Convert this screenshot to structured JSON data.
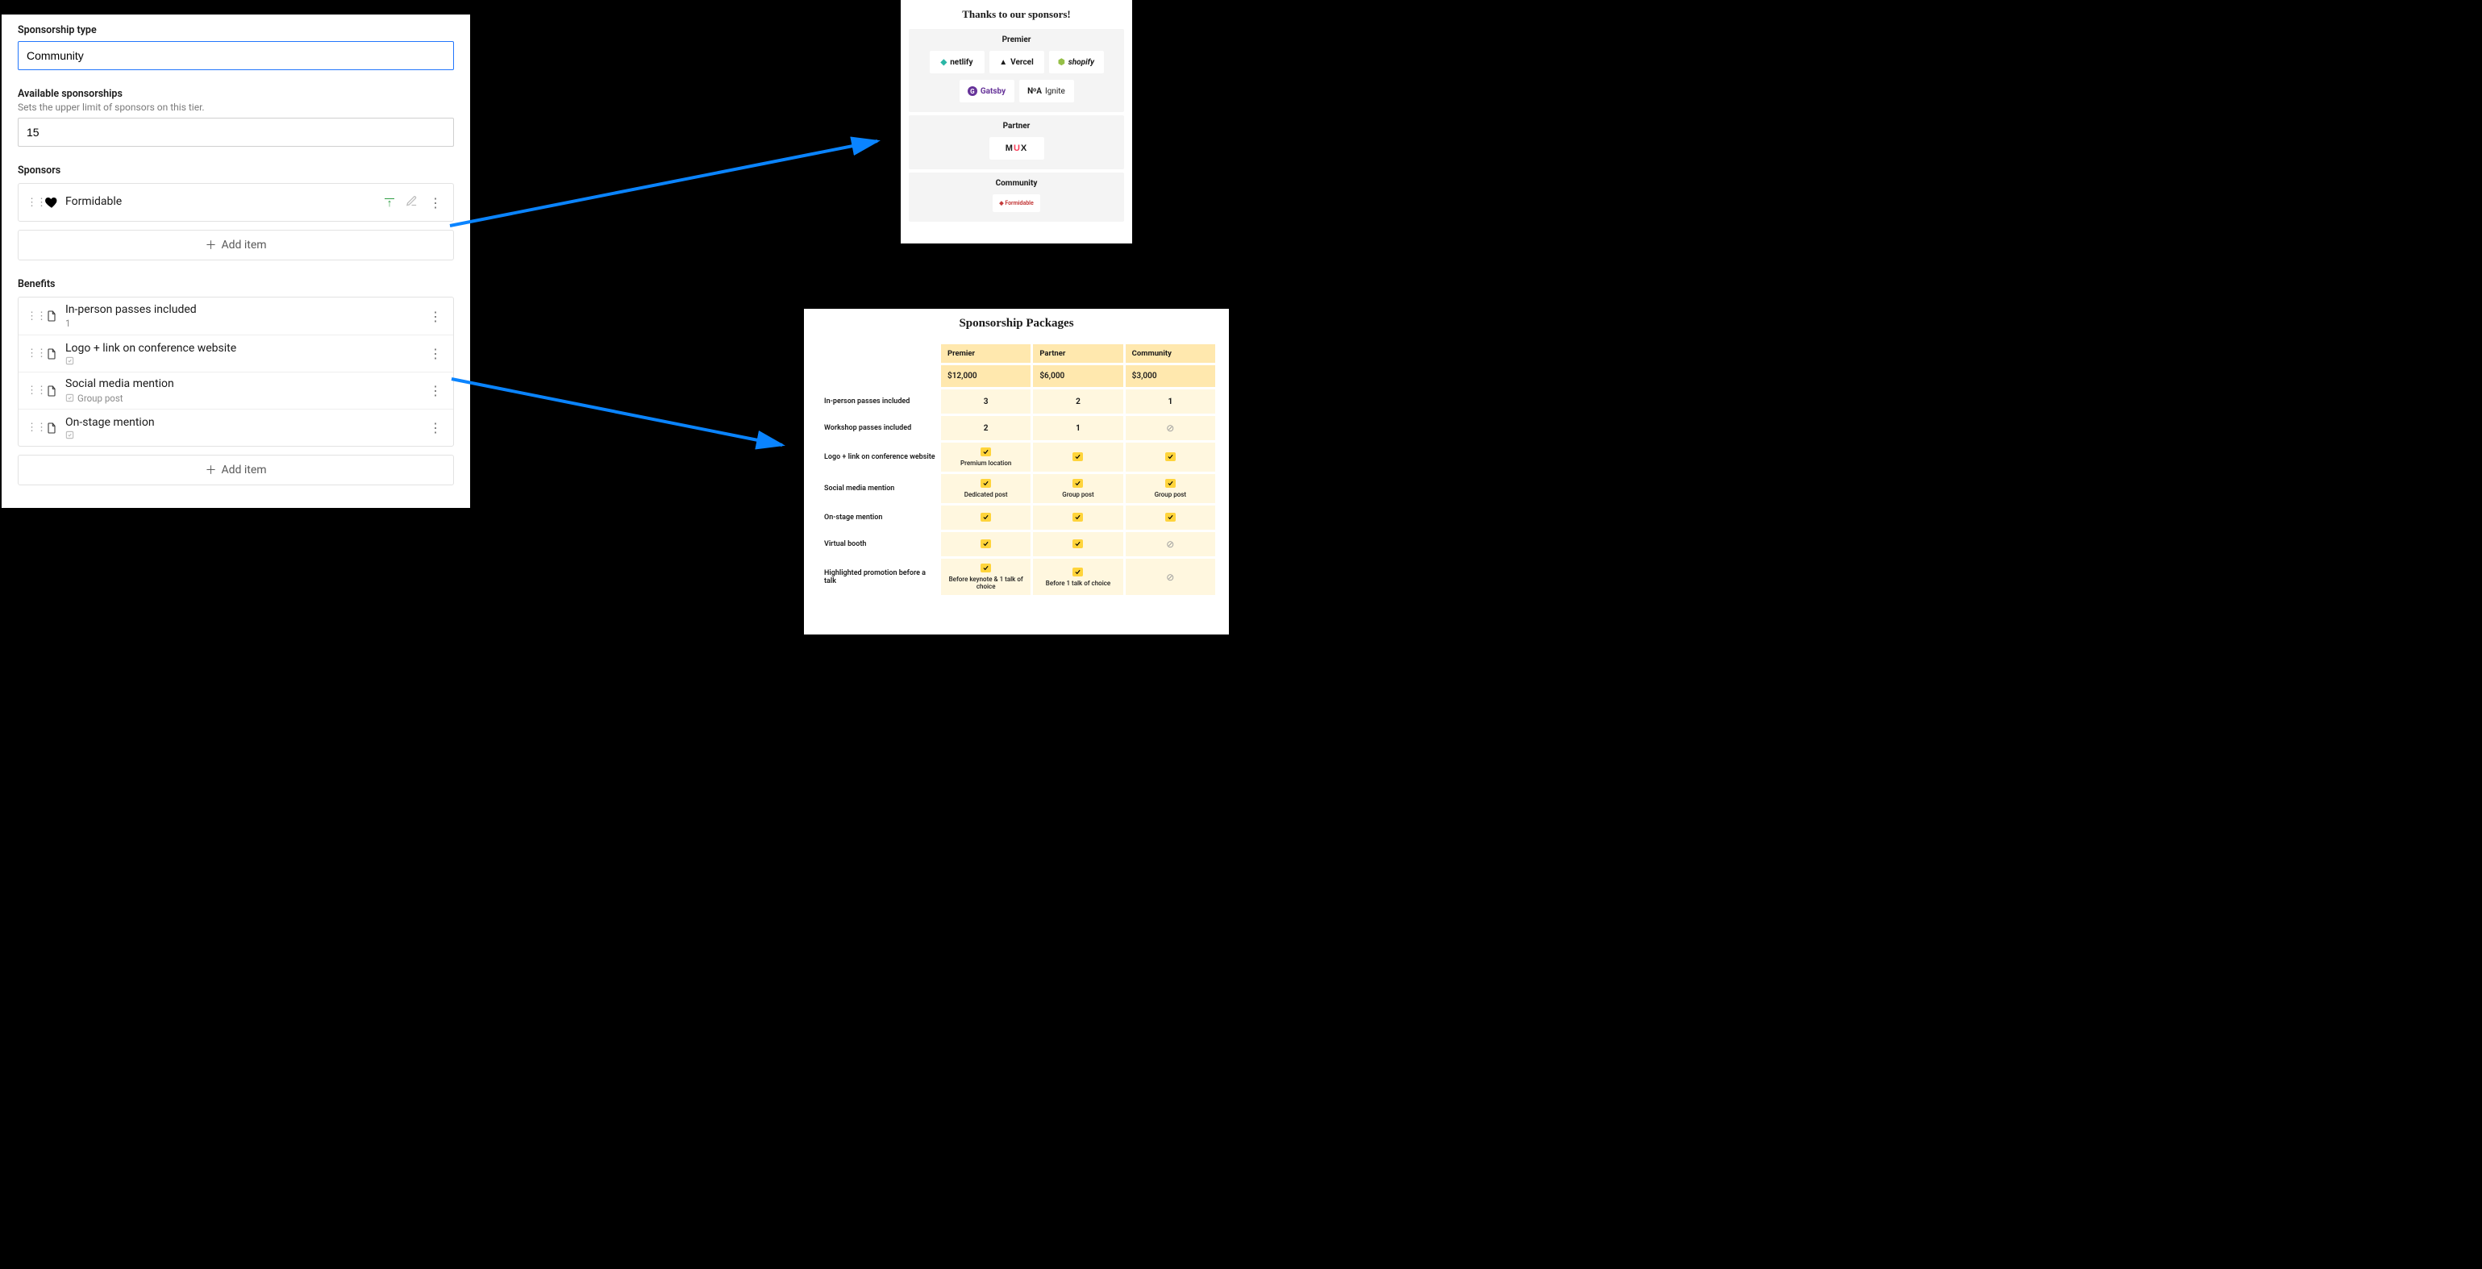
{
  "form": {
    "type_label": "Sponsorship type",
    "type_value": "Community",
    "avail_label": "Available sponsorships",
    "avail_hint": "Sets the upper limit of sponsors on this tier.",
    "avail_value": "15",
    "sponsors_label": "Sponsors",
    "sponsor_row": {
      "name": "Formidable"
    },
    "benefits_label": "Benefits",
    "benefits": [
      {
        "title": "In-person passes included",
        "meta": "1"
      },
      {
        "title": "Logo + link on conference website",
        "meta_check": true
      },
      {
        "title": "Social media mention",
        "meta_check": true,
        "meta": "Group post"
      },
      {
        "title": "On-stage mention",
        "meta_check": true
      }
    ],
    "add_item": "Add item"
  },
  "sponsors_card": {
    "title": "Thanks to our sponsors!",
    "tiers": [
      {
        "name": "Premier",
        "logos": [
          "netlify",
          "Vercel",
          "shopify",
          "Gatsby",
          "NoA Ignite"
        ]
      },
      {
        "name": "Partner",
        "logos": [
          "MUX"
        ]
      },
      {
        "name": "Community",
        "logos": [
          "Formidable"
        ]
      }
    ]
  },
  "packages": {
    "title": "Sponsorship Packages",
    "columns": [
      "Premier",
      "Partner",
      "Community"
    ],
    "prices": [
      "$12,000",
      "$6,000",
      "$3,000"
    ],
    "rows": [
      {
        "label": "In-person passes included",
        "cells": [
          "3",
          "2",
          "1"
        ]
      },
      {
        "label": "Workshop passes included",
        "cells": [
          "2",
          "1",
          "na"
        ]
      },
      {
        "label": "Logo + link on conference website",
        "cells": [
          [
            "check",
            "Premium location"
          ],
          "check",
          "check"
        ]
      },
      {
        "label": "Social media mention",
        "cells": [
          [
            "check",
            "Dedicated post"
          ],
          [
            "check",
            "Group post"
          ],
          [
            "check",
            "Group post"
          ]
        ]
      },
      {
        "label": "On-stage mention",
        "cells": [
          "check",
          "check",
          "check"
        ]
      },
      {
        "label": "Virtual booth",
        "cells": [
          "check",
          "check",
          "na"
        ]
      },
      {
        "label": "Highlighted promotion before a talk",
        "cells": [
          [
            "check",
            "Before keynote & 1 talk of choice"
          ],
          [
            "check",
            "Before 1 talk of choice"
          ],
          "na"
        ]
      }
    ]
  }
}
